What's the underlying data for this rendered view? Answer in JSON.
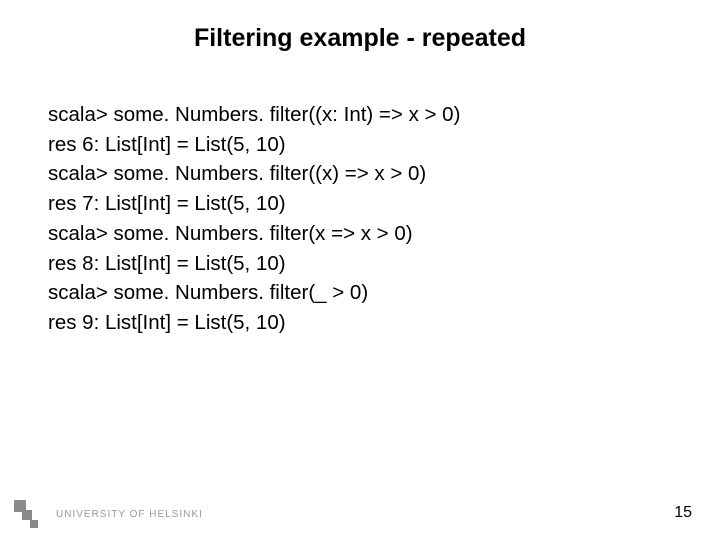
{
  "title": "Filtering example - repeated",
  "code": {
    "l1": "scala> some. Numbers. filter((x: Int) => x > 0)",
    "l2": "res 6: List[Int] = List(5, 10)",
    "l3": "scala> some. Numbers. filter((x) => x > 0)",
    "l4": "res 7: List[Int] = List(5, 10)",
    "l5": "scala> some. Numbers. filter(x => x > 0)",
    "l6": "res 8: List[Int] = List(5, 10)",
    "l7": "scala> some. Numbers. filter(_ > 0)",
    "l8": "res 9: List[Int] = List(5, 10)"
  },
  "footer": {
    "org": "University of Helsinki"
  },
  "page_number": "15"
}
